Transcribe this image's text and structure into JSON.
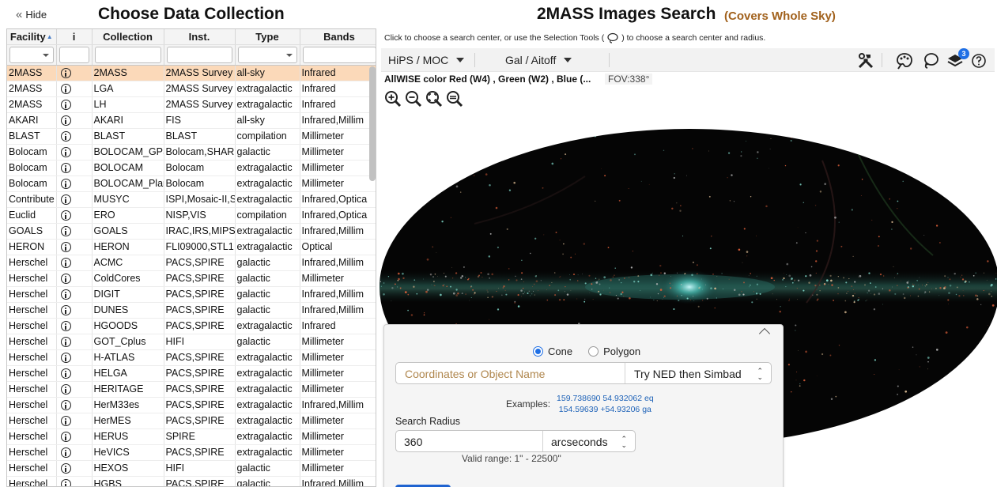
{
  "left_panel": {
    "hide_label": "Hide",
    "title": "Choose Data Collection",
    "columns": [
      "Facility",
      "i",
      "Collection",
      "Inst.",
      "Type",
      "Bands"
    ],
    "rows": [
      {
        "facility": "2MASS",
        "collection": "2MASS",
        "inst": "2MASS Survey",
        "type": "all-sky",
        "bands": "Infrared",
        "selected": true
      },
      {
        "facility": "2MASS",
        "collection": "LGA",
        "inst": "2MASS Survey",
        "type": "extragalactic",
        "bands": "Infrared"
      },
      {
        "facility": "2MASS",
        "collection": "LH",
        "inst": "2MASS Survey",
        "type": "extragalactic",
        "bands": "Infrared"
      },
      {
        "facility": "AKARI",
        "collection": "AKARI",
        "inst": "FIS",
        "type": "all-sky",
        "bands": "Infrared,Millim"
      },
      {
        "facility": "BLAST",
        "collection": "BLAST",
        "inst": "BLAST",
        "type": "compilation",
        "bands": "Millimeter"
      },
      {
        "facility": "Bolocam",
        "collection": "BOLOCAM_GPS",
        "inst": "Bolocam,SHAR",
        "type": "galactic",
        "bands": "Millimeter"
      },
      {
        "facility": "Bolocam",
        "collection": "BOLOCAM",
        "inst": "Bolocam",
        "type": "extragalactic",
        "bands": "Millimeter"
      },
      {
        "facility": "Bolocam",
        "collection": "BOLOCAM_Plar",
        "inst": "Bolocam",
        "type": "extragalactic",
        "bands": "Millimeter"
      },
      {
        "facility": "Contribute",
        "collection": "MUSYC",
        "inst": "ISPI,Mosaic-II,S",
        "type": "extragalactic",
        "bands": "Infrared,Optica"
      },
      {
        "facility": "Euclid",
        "collection": "ERO",
        "inst": "NISP,VIS",
        "type": "compilation",
        "bands": "Infrared,Optica"
      },
      {
        "facility": "GOALS",
        "collection": "GOALS",
        "inst": "IRAC,IRS,MIPS,",
        "type": "extragalactic",
        "bands": "Infrared,Millim"
      },
      {
        "facility": "HERON",
        "collection": "HERON",
        "inst": "FLI09000,STL1",
        "type": "extragalactic",
        "bands": "Optical"
      },
      {
        "facility": "Herschel",
        "collection": "ACMC",
        "inst": "PACS,SPIRE",
        "type": "galactic",
        "bands": "Infrared,Millim"
      },
      {
        "facility": "Herschel",
        "collection": "ColdCores",
        "inst": "PACS,SPIRE",
        "type": "galactic",
        "bands": "Millimeter"
      },
      {
        "facility": "Herschel",
        "collection": "DIGIT",
        "inst": "PACS,SPIRE",
        "type": "galactic",
        "bands": "Infrared,Millim"
      },
      {
        "facility": "Herschel",
        "collection": "DUNES",
        "inst": "PACS,SPIRE",
        "type": "galactic",
        "bands": "Infrared,Millim"
      },
      {
        "facility": "Herschel",
        "collection": "HGOODS",
        "inst": "PACS,SPIRE",
        "type": "extragalactic",
        "bands": "Infrared"
      },
      {
        "facility": "Herschel",
        "collection": "GOT_Cplus",
        "inst": "HIFI",
        "type": "galactic",
        "bands": "Millimeter"
      },
      {
        "facility": "Herschel",
        "collection": "H-ATLAS",
        "inst": "PACS,SPIRE",
        "type": "extragalactic",
        "bands": "Millimeter"
      },
      {
        "facility": "Herschel",
        "collection": "HELGA",
        "inst": "PACS,SPIRE",
        "type": "extragalactic",
        "bands": "Millimeter"
      },
      {
        "facility": "Herschel",
        "collection": "HERITAGE",
        "inst": "PACS,SPIRE",
        "type": "extragalactic",
        "bands": "Millimeter"
      },
      {
        "facility": "Herschel",
        "collection": "HerM33es",
        "inst": "PACS,SPIRE",
        "type": "extragalactic",
        "bands": "Infrared,Millim"
      },
      {
        "facility": "Herschel",
        "collection": "HerMES",
        "inst": "PACS,SPIRE",
        "type": "extragalactic",
        "bands": "Millimeter"
      },
      {
        "facility": "Herschel",
        "collection": "HERUS",
        "inst": "SPIRE",
        "type": "extragalactic",
        "bands": "Millimeter"
      },
      {
        "facility": "Herschel",
        "collection": "HeVICS",
        "inst": "PACS,SPIRE",
        "type": "extragalactic",
        "bands": "Millimeter"
      },
      {
        "facility": "Herschel",
        "collection": "HEXOS",
        "inst": "HIFI",
        "type": "galactic",
        "bands": "Millimeter"
      },
      {
        "facility": "Herschel",
        "collection": "HGBS",
        "inst": "PACS,SPIRE",
        "type": "galactic",
        "bands": "Infrared,Millim"
      }
    ]
  },
  "right_panel": {
    "title": "2MASS Images Search",
    "subtitle": "(Covers Whole Sky)",
    "hint_before": "Click to choose a search center, or use the Selection Tools (",
    "hint_after": ") to choose a search center and radius.",
    "toolbar": {
      "hips_moc_label": "HiPS / MOC",
      "projection_label": "Gal / Aitoff",
      "layers_badge": "3"
    },
    "image_title": "AllWISE color Red (W4) , Green (W2) , Blue (...",
    "fov": "FOV:338°",
    "icons": [
      "zoom-in-icon",
      "zoom-out-icon",
      "zoom-fit-icon",
      "zoom-fill-icon",
      "tools-icon",
      "palette-icon",
      "lasso-icon",
      "layers-icon",
      "help-icon"
    ]
  },
  "search_panel": {
    "radio_cone": "Cone",
    "radio_polygon": "Polygon",
    "coords_placeholder": "Coordinates or Object Name",
    "resolver": "Try NED then Simbad",
    "examples_label": "Examples:",
    "example_1": "159.738690 54.932062 eq",
    "example_2": "154.59639 +54.93206 ga",
    "radius_label": "Search Radius",
    "radius_value": "360",
    "radius_unit": "arcseconds",
    "valid_range": "Valid range: 1\" - 22500\""
  },
  "colors": {
    "selected_row": "#fbd9b9",
    "subtitle": "#a1611c",
    "accent": "#1f6fe5",
    "placeholder": "#b0874e"
  }
}
